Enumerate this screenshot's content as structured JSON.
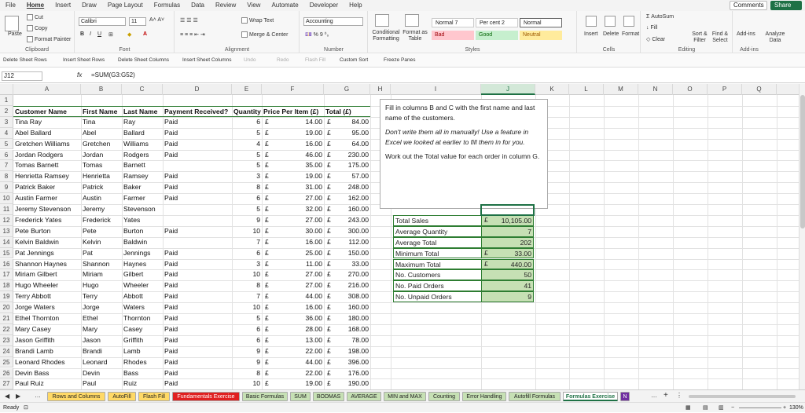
{
  "menu": {
    "tabs": [
      "File",
      "Home",
      "Insert",
      "Draw",
      "Page Layout",
      "Formulas",
      "Data",
      "Review",
      "View",
      "Automate",
      "Developer",
      "Help"
    ],
    "comments": "Comments",
    "share": "Share"
  },
  "ribbon": {
    "clipboard": {
      "paste": "Paste",
      "cut": "Cut",
      "copy": "Copy",
      "painter": "Format Painter",
      "label": "Clipboard"
    },
    "font": {
      "family": "Calibri",
      "size": "11",
      "label": "Font"
    },
    "alignment": {
      "wrap": "Wrap Text",
      "merge": "Merge & Center",
      "label": "Alignment"
    },
    "number": {
      "format": "Accounting",
      "label": "Number"
    },
    "styles": {
      "cond": "Conditional Formatting",
      "table": "Format as Table",
      "normal7": "Normal 7",
      "percent2": "Per cent 2",
      "normal": "Normal",
      "bad": "Bad",
      "good": "Good",
      "neutral": "Neutral",
      "label": "Styles"
    },
    "cells": {
      "insert": "Insert",
      "delete": "Delete",
      "format": "Format",
      "label": "Cells"
    },
    "editing": {
      "autosum": "AutoSum",
      "fill": "Fill",
      "clear": "Clear",
      "sort": "Sort & Filter",
      "find": "Find & Select",
      "label": "Editing"
    },
    "addins": {
      "addins": "Add-ins",
      "analyze": "Analyze Data",
      "label": "Add-ins"
    }
  },
  "quick": [
    "Delete Sheet Rows",
    "Insert Sheet Rows",
    "Delete Sheet Columns",
    "Insert Sheet Columns",
    "Undo",
    "Redo",
    "Flash Fill",
    "Custom Sort",
    "Freeze Panes"
  ],
  "formula_bar": {
    "namebox": "J12",
    "fx": "fx",
    "formula": "=SUM(G3:G52)"
  },
  "columns": [
    "A",
    "B",
    "C",
    "D",
    "E",
    "F",
    "G",
    "H",
    "I",
    "J",
    "K",
    "L",
    "M",
    "N",
    "O",
    "P",
    "Q"
  ],
  "headers": [
    "Customer Name",
    "First Name",
    "Last Name",
    "Payment Received?",
    "Quantity",
    "Price Per Item (£)",
    "Total (£)"
  ],
  "rows": [
    [
      "Tina Ray",
      "Tina",
      "Ray",
      "Paid",
      "6",
      "14.00",
      "84.00"
    ],
    [
      "Abel Ballard",
      "Abel",
      "Ballard",
      "Paid",
      "5",
      "19.00",
      "95.00"
    ],
    [
      "Gretchen Williams",
      "Gretchen",
      "Williams",
      "Paid",
      "4",
      "16.00",
      "64.00"
    ],
    [
      "Jordan Rodgers",
      "Jordan",
      "Rodgers",
      "Paid",
      "5",
      "46.00",
      "230.00"
    ],
    [
      "Tomas Barnett",
      "Tomas",
      "Barnett",
      "",
      "5",
      "35.00",
      "175.00"
    ],
    [
      "Henrietta Ramsey",
      "Henrietta",
      "Ramsey",
      "Paid",
      "3",
      "19.00",
      "57.00"
    ],
    [
      "Patrick Baker",
      "Patrick",
      "Baker",
      "Paid",
      "8",
      "31.00",
      "248.00"
    ],
    [
      "Austin Farmer",
      "Austin",
      "Farmer",
      "Paid",
      "6",
      "27.00",
      "162.00"
    ],
    [
      "Jeremy Stevenson",
      "Jeremy",
      "Stevenson",
      "",
      "5",
      "32.00",
      "160.00"
    ],
    [
      "Frederick Yates",
      "Frederick",
      "Yates",
      "",
      "9",
      "27.00",
      "243.00"
    ],
    [
      "Pete Burton",
      "Pete",
      "Burton",
      "Paid",
      "10",
      "30.00",
      "300.00"
    ],
    [
      "Kelvin Baldwin",
      "Kelvin",
      "Baldwin",
      "",
      "7",
      "16.00",
      "112.00"
    ],
    [
      "Pat Jennings",
      "Pat",
      "Jennings",
      "Paid",
      "6",
      "25.00",
      "150.00"
    ],
    [
      "Shannon Haynes",
      "Shannon",
      "Haynes",
      "Paid",
      "3",
      "11.00",
      "33.00"
    ],
    [
      "Miriam Gilbert",
      "Miriam",
      "Gilbert",
      "Paid",
      "10",
      "27.00",
      "270.00"
    ],
    [
      "Hugo Wheeler",
      "Hugo",
      "Wheeler",
      "Paid",
      "8",
      "27.00",
      "216.00"
    ],
    [
      "Terry Abbott",
      "Terry",
      "Abbott",
      "Paid",
      "7",
      "44.00",
      "308.00"
    ],
    [
      "Jorge Waters",
      "Jorge",
      "Waters",
      "Paid",
      "10",
      "16.00",
      "160.00"
    ],
    [
      "Ethel Thornton",
      "Ethel",
      "Thornton",
      "Paid",
      "5",
      "36.00",
      "180.00"
    ],
    [
      "Mary Casey",
      "Mary",
      "Casey",
      "Paid",
      "6",
      "28.00",
      "168.00"
    ],
    [
      "Jason Griffith",
      "Jason",
      "Griffith",
      "Paid",
      "6",
      "13.00",
      "78.00"
    ],
    [
      "Brandi Lamb",
      "Brandi",
      "Lamb",
      "Paid",
      "9",
      "22.00",
      "198.00"
    ],
    [
      "Leonard Rhodes",
      "Leonard",
      "Rhodes",
      "Paid",
      "9",
      "44.00",
      "396.00"
    ],
    [
      "Devin Bass",
      "Devin",
      "Bass",
      "Paid",
      "8",
      "22.00",
      "176.00"
    ],
    [
      "Paul Ruiz",
      "Paul",
      "Ruiz",
      "Paid",
      "10",
      "19.00",
      "190.00"
    ]
  ],
  "currency": "£",
  "note": {
    "p1": "Fill in columns B and C with the first name and last name of the customers.",
    "p2": "Don't write them all in manually! Use a feature in Excel we looked at earlier to fill them in for you.",
    "p3": "Work out the Total value for each order in column G."
  },
  "stats": [
    {
      "label": "Total Sales",
      "cur": "£",
      "value": "10,105.00"
    },
    {
      "label": "Average Quantity",
      "cur": "",
      "value": "7"
    },
    {
      "label": "Average Total",
      "cur": "",
      "value": "202"
    },
    {
      "label": "Minimum Total",
      "cur": "£",
      "value": "33.00"
    },
    {
      "label": "Maximum Total",
      "cur": "£",
      "value": "440.00"
    },
    {
      "label": "No. Customers",
      "cur": "",
      "value": "50"
    },
    {
      "label": "No. Paid Orders",
      "cur": "",
      "value": "41"
    },
    {
      "label": "No. Unpaid Orders",
      "cur": "",
      "value": "9"
    }
  ],
  "sheet_tabs": [
    {
      "label": "Rows and Columns",
      "color": "#ffd966",
      "text": "#222"
    },
    {
      "label": "AutoFill",
      "color": "#ffd966",
      "text": "#222"
    },
    {
      "label": "Flash Fill",
      "color": "#ffd966",
      "text": "#222"
    },
    {
      "label": "Fundamentals Exercise",
      "color": "#e02020",
      "text": "#fff"
    },
    {
      "label": "Basic Formulas",
      "color": "#c6e0b4",
      "text": "#222"
    },
    {
      "label": "SUM",
      "color": "#c6e0b4",
      "text": "#222"
    },
    {
      "label": "BODMAS",
      "color": "#c6e0b4",
      "text": "#222"
    },
    {
      "label": "AVERAGE",
      "color": "#c6e0b4",
      "text": "#222"
    },
    {
      "label": "MIN and MAX",
      "color": "#c6e0b4",
      "text": "#222"
    },
    {
      "label": "Counting",
      "color": "#c6e0b4",
      "text": "#222"
    },
    {
      "label": "Error Handling",
      "color": "#c6e0b4",
      "text": "#222"
    },
    {
      "label": "Autofill Formulas",
      "color": "#c6e0b4",
      "text": "#222"
    },
    {
      "label": "Formulas Exercise",
      "color": "#ffffff",
      "text": "#1e7145"
    },
    {
      "label": "N",
      "color": "#7030a0",
      "text": "#fff"
    }
  ],
  "status": {
    "ready": "Ready",
    "zoom": "130%"
  }
}
